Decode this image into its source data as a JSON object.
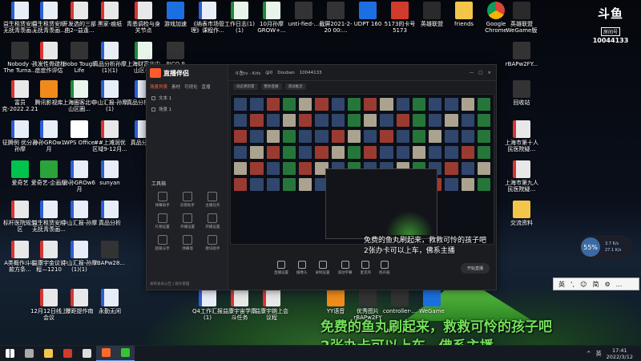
{
  "desktop": {
    "icons": [
      {
        "label": "益生租赁安顺无抚青羡画...",
        "type": "doc"
      },
      {
        "label": "益生租赁安顺无抚青羡画...",
        "type": "doc"
      },
      {
        "label": "开发选的三部曲2--益逢...",
        "type": "pdf"
      },
      {
        "label": "黑家-痕纸",
        "type": "pdf"
      },
      {
        "label": "青悉调检与身关节点",
        "type": "pdf"
      },
      {
        "label": "游戏加速",
        "type": "blue"
      },
      {
        "label": "《纳表市场管理》课程作...",
        "type": "doc"
      },
      {
        "label": "工作日志(1)(1)",
        "type": "xls"
      },
      {
        "label": "10月孙摩GROW+...",
        "type": "xls"
      },
      {
        "label": "unti-fied-...",
        "type": "dark"
      },
      {
        "label": "截屏2021-2-20 00:...",
        "type": "dark"
      },
      {
        "label": "UDPT 160",
        "type": "blue"
      },
      {
        "label": "5173的卡号5173",
        "type": "red"
      },
      {
        "label": "英雄联盟",
        "type": "app"
      },
      {
        "label": "friends",
        "type": "folder"
      },
      {
        "label": "Google Chrome",
        "type": "chrome"
      },
      {
        "label": "英雄联盟 WeGame版",
        "type": "app"
      },
      {
        "label": "Nobody - The Turna...",
        "type": "dark"
      },
      {
        "label": "孩发性骨疏松症症作评估",
        "type": "pdf"
      },
      {
        "label": "Hobo Tough Life",
        "type": "dark"
      },
      {
        "label": "真品分析孙摩(1)(1)",
        "type": "doc"
      },
      {
        "label": "上海财富北中山区(1)",
        "type": "xls"
      },
      {
        "label": "富员克-2022.2.21",
        "type": "pdf"
      },
      {
        "label": "腾讯影视库",
        "type": "orange"
      },
      {
        "label": "上海圈客北中山区圈...",
        "type": "xls"
      },
      {
        "label": "中山汇报-孙摩(1)",
        "type": "doc"
      },
      {
        "label": "征腾例 优分孙孙摩",
        "type": "doc"
      },
      {
        "label": "孙孙GROw1月",
        "type": "doc"
      },
      {
        "label": "WPS Office",
        "type": "wps"
      },
      {
        "label": "##上滩润优区域9-12月...",
        "type": "pdf"
      },
      {
        "label": "爱奇艺",
        "type": "iqiyi"
      },
      {
        "label": "爱奇艺-企画版",
        "type": "green"
      },
      {
        "label": "孙孙GROw6月",
        "type": "doc"
      },
      {
        "label": "sunyan",
        "type": "doc"
      },
      {
        "label": "真品分析孙摩",
        "type": "doc"
      },
      {
        "label": "PICO P",
        "type": "dark"
      },
      {
        "label": "益生租赁安顺无抚青羡画...",
        "type": "doc"
      },
      {
        "label": "中山汇报-孙摩",
        "type": "doc"
      },
      {
        "label": "真品分析",
        "type": "doc"
      },
      {
        "label": "标杆医院规划区",
        "type": "pdf"
      },
      {
        "label": "益康宇金议议程—1210",
        "type": "pdf"
      },
      {
        "label": "中山汇报-孙摩(1)(1)",
        "type": "doc"
      },
      {
        "label": "rBAPw28...",
        "type": "dark"
      },
      {
        "label": "A类概作斗收款方条...",
        "type": "pdf"
      },
      {
        "label": "12月12日线上会议",
        "type": "pdf"
      },
      {
        "label": "曝距提作南",
        "type": "pdf"
      },
      {
        "label": "永勤无闲",
        "type": "doc"
      },
      {
        "label": "真品分析1",
        "type": "doc"
      },
      {
        "label": "工作日志(1)(1)",
        "type": "doc"
      },
      {
        "label": "Q4工作汇报(1)",
        "type": "doc"
      },
      {
        "label": "益康宇宙学康斗任务",
        "type": "pdf"
      },
      {
        "label": "益康宇婉上会议程",
        "type": "pdf"
      },
      {
        "label": "YY语音",
        "type": "orange"
      },
      {
        "label": "优秀图片 rBAPw2FY",
        "type": "dark"
      },
      {
        "label": "controller-...",
        "type": "dark"
      },
      {
        "label": "WeGame",
        "type": "blue"
      },
      {
        "label": "rBAPw2FY...",
        "type": "dark"
      },
      {
        "label": "回收站",
        "type": "dark"
      },
      {
        "label": "上海市第十人民医院疑...",
        "type": "pdf"
      },
      {
        "label": "上海市第九人民医院疑...",
        "type": "pdf"
      },
      {
        "label": "交流资料",
        "type": "folder"
      }
    ]
  },
  "douyu": {
    "logo": "斗鱼",
    "sub": "房间号",
    "room": "10044133"
  },
  "app": {
    "title": "直播伴侣",
    "tabs": [
      "场景列表",
      "素材",
      "可视化",
      "直播"
    ],
    "scenes": [
      "文本 1",
      "场景 1"
    ],
    "tools_title": "工具箱",
    "tools": [
      "弹幕助手",
      "房管助手",
      "主播任务",
      "礼物设置",
      "开播设置",
      "开播设置",
      "超级分享",
      "弹幕墙",
      "歌词助手"
    ],
    "footer": "发布会员公告 | 观众管理",
    "header_items": [
      "斗鱼tv - KrIs",
      "@0",
      "Douban",
      "10044133"
    ],
    "header_buttons": [
      "—",
      "□",
      "×"
    ],
    "sub_chips": [
      "动态更新量",
      "整体直播",
      "测试推流"
    ],
    "bottom_buttons": [
      "直播设置",
      "摄像头",
      "录制设置",
      "滚动字幕",
      "麦克风",
      "扬声器"
    ],
    "start_label": "开始直播",
    "preview_caption_line1": "免费的鱼丸刷起来，救救可怜的孩子吧",
    "preview_caption_line2": "2张办卡可以上车，佛系主播"
  },
  "network": {
    "percent": "55%",
    "up": "3.7 K/s",
    "down": "27.1 K/s"
  },
  "ime": {
    "items": [
      "英",
      "‘,",
      "☺",
      "简",
      "⚙",
      "…"
    ]
  },
  "caption": {
    "line1": "免费的鱼丸刷起来，救救可怜的孩子吧",
    "line2": "2张办卡可以上车，佛系主播"
  },
  "taskbar": {
    "ime_indicator": "英",
    "time": "17:41",
    "date": "2022/3/12"
  }
}
